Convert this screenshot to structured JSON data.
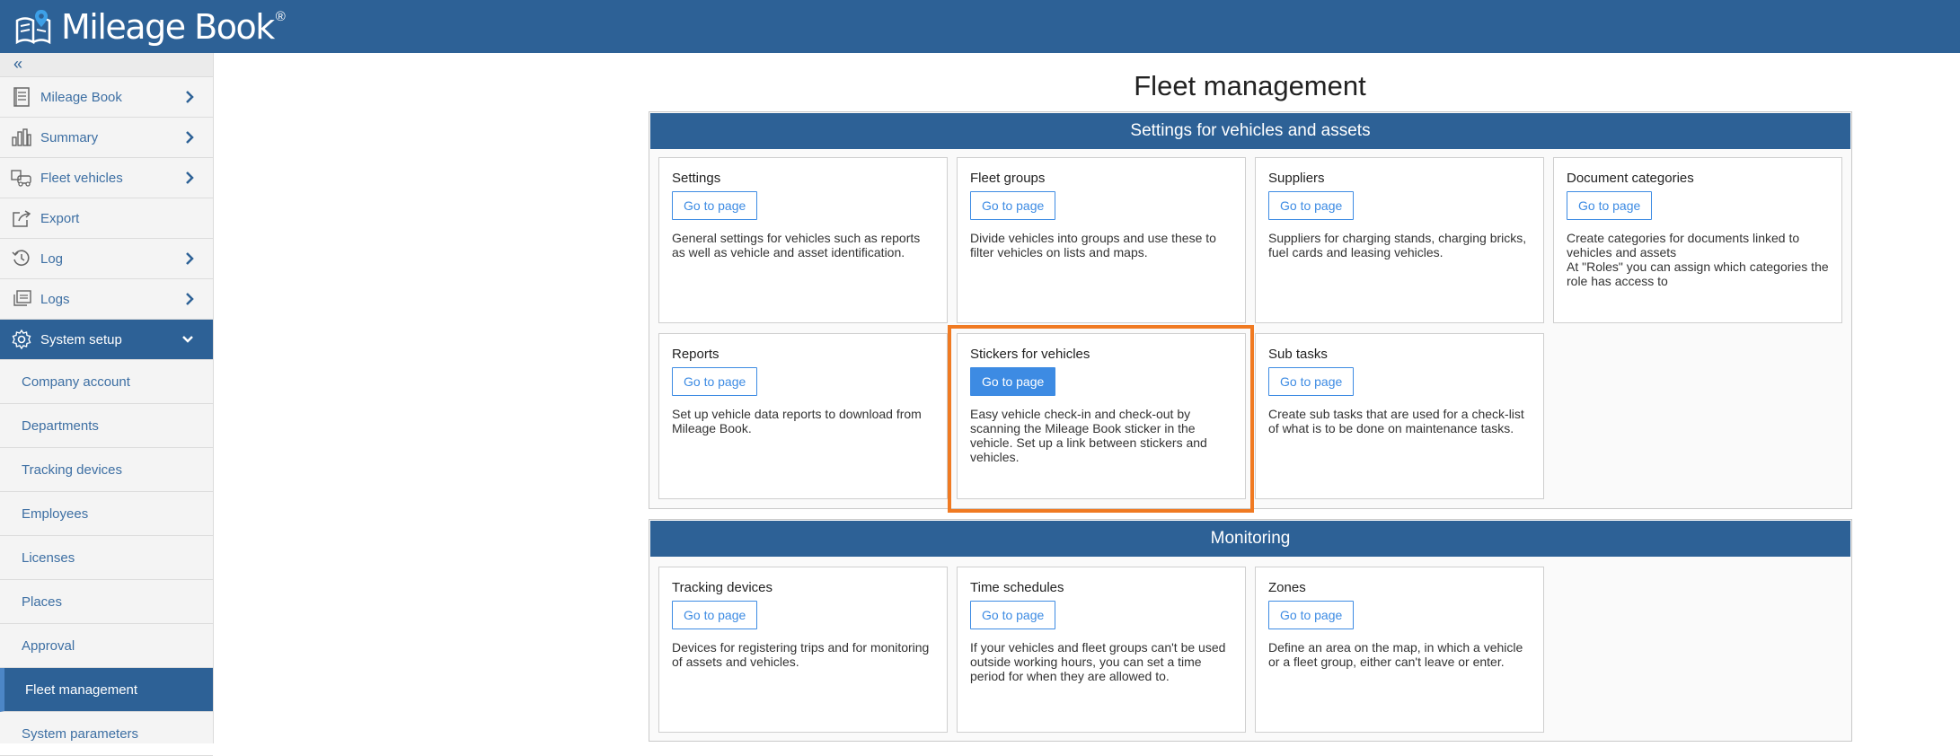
{
  "app": {
    "name": "Mileage Book",
    "reg": "®"
  },
  "sidebar": {
    "collapse_label": "«",
    "items": [
      {
        "label": "Mileage Book",
        "icon": "book-icon",
        "chevron": true
      },
      {
        "label": "Summary",
        "icon": "bar-chart-icon",
        "chevron": true
      },
      {
        "label": "Fleet vehicles",
        "icon": "fleet-icon",
        "chevron": true
      },
      {
        "label": "Export",
        "icon": "export-icon",
        "chevron": false
      },
      {
        "label": "Log",
        "icon": "history-icon",
        "chevron": true
      },
      {
        "label": "Logs",
        "icon": "logs-icon",
        "chevron": true
      },
      {
        "label": "System setup",
        "icon": "gear-icon",
        "chevron": true
      }
    ],
    "sub_items": [
      "Company account",
      "Departments",
      "Tracking devices",
      "Employees",
      "Licenses",
      "Places",
      "Approval",
      "Fleet management",
      "System parameters"
    ]
  },
  "main": {
    "title": "Fleet management",
    "sections": [
      {
        "heading": "Settings for vehicles and assets",
        "cards": [
          {
            "title": "Settings",
            "button": "Go to page",
            "desc": "General settings for vehicles such as reports as well as vehicle and asset identification."
          },
          {
            "title": "Fleet groups",
            "button": "Go to page",
            "desc": "Divide vehicles into groups and use these to filter vehicles on lists and maps."
          },
          {
            "title": "Suppliers",
            "button": "Go to page",
            "desc": "Suppliers for charging stands, charging bricks, fuel cards and leasing vehicles."
          },
          {
            "title": "Document categories",
            "button": "Go to page",
            "desc": "Create categories for documents linked to vehicles and assets\nAt \"Roles\" you can assign which categories the role has access to"
          },
          {
            "title": "Reports",
            "button": "Go to page",
            "desc": "Set up vehicle data reports to download from Mileage Book."
          },
          {
            "title": "Stickers for vehicles",
            "button": "Go to page",
            "desc": "Easy vehicle check-in and check-out by scanning the Mileage Book sticker in the vehicle. Set up a link between stickers and vehicles."
          },
          {
            "title": "Sub tasks",
            "button": "Go to page",
            "desc": "Create sub tasks that are used for a check-list of what is to be done on maintenance tasks."
          }
        ]
      },
      {
        "heading": "Monitoring",
        "cards": [
          {
            "title": "Tracking devices",
            "button": "Go to page",
            "desc": "Devices for registering trips and for monitoring of assets and vehicles."
          },
          {
            "title": "Time schedules",
            "button": "Go to page",
            "desc": "If your vehicles and fleet groups can't be used outside working hours, you can set a time period for when they are allowed to."
          },
          {
            "title": "Zones",
            "button": "Go to page",
            "desc": "Define an area on the map, in which a vehicle or a fleet group, either can't leave or enter."
          }
        ]
      }
    ]
  },
  "colors": {
    "header": "#2d6196",
    "accent": "#3d8be3",
    "highlight": "#f07a22"
  }
}
